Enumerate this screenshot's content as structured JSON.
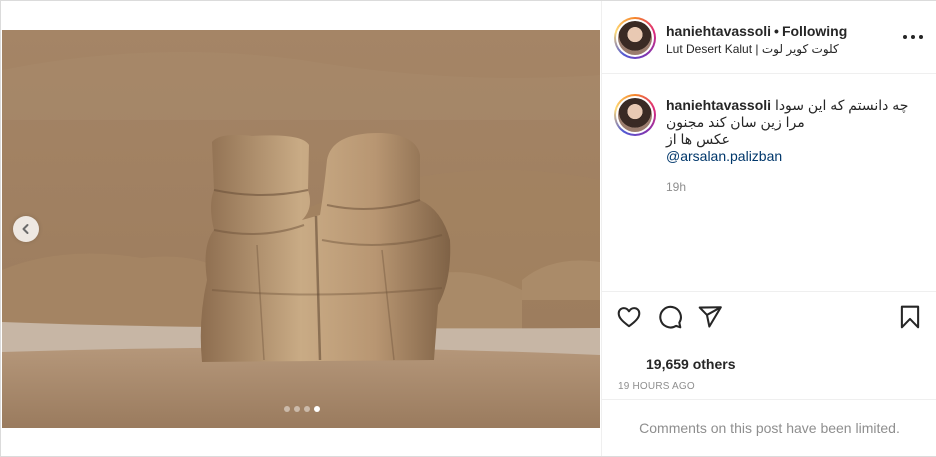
{
  "post": {
    "username": "haniehtavassoli",
    "separator": "•",
    "follow_status": "Following",
    "location": "Lut Desert Kalut | کلوت کویر لوت",
    "caption": {
      "username": "haniehtavassoli",
      "line1": "چه دانستم که این سودا",
      "line2": "مرا زین سان کند مجنون",
      "line3": "عکس ها از",
      "mention": "@arsalan.palizban",
      "time": "19h"
    },
    "likes": "19,659 others",
    "posted_time": "19 HOURS AGO",
    "comments_notice": "Comments on this post have been limited.",
    "carousel": {
      "count": 4,
      "active_index": 3
    }
  },
  "icons": {
    "prev": "chevron-left-icon",
    "more": "more-options-icon",
    "like": "heart-icon",
    "comment": "comment-icon",
    "share": "share-icon",
    "save": "bookmark-icon"
  }
}
